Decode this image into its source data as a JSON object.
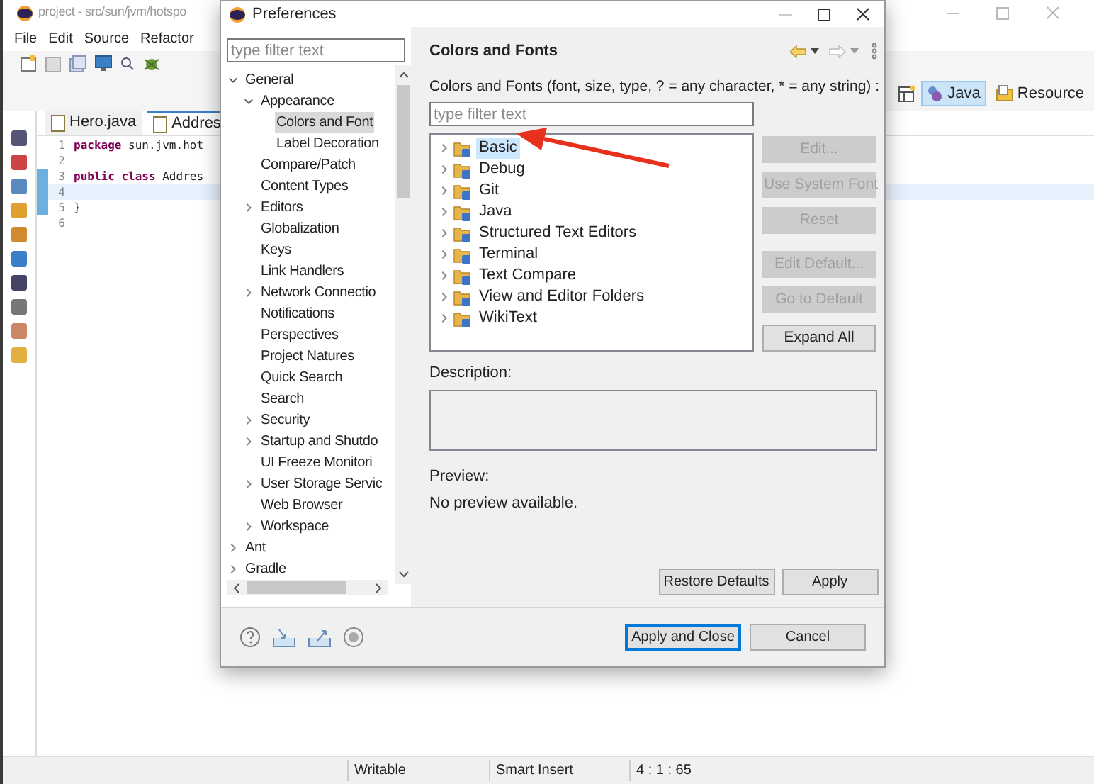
{
  "ide": {
    "title": "project - src/sun/jvm/hotspo",
    "menu": [
      "File",
      "Edit",
      "Source",
      "Refactor"
    ],
    "perspectives": [
      {
        "label": "Java",
        "selected": true
      },
      {
        "label": "Resource",
        "selected": false
      }
    ],
    "editor_tabs": [
      {
        "label": "Hero.java",
        "selected": false
      },
      {
        "label": "Addres",
        "selected": true
      }
    ],
    "code_lines": [
      {
        "number": "1",
        "current": false,
        "tokens": [
          {
            "text": "package",
            "kind": "keyword"
          },
          {
            "text": " sun.jvm.hot",
            "kind": "plain"
          }
        ]
      },
      {
        "number": "2",
        "current": false
      },
      {
        "number": "3",
        "current": false,
        "tokens": [
          {
            "text": "public class",
            "kind": "keyword"
          },
          {
            "text": " Addres",
            "kind": "plain"
          }
        ]
      },
      {
        "number": "4",
        "current": true
      },
      {
        "number": "5",
        "current": false,
        "tokens": [
          {
            "text": "}",
            "kind": "plain"
          }
        ]
      },
      {
        "number": "6",
        "current": false
      }
    ],
    "status_bar": [
      "Writable",
      "Smart Insert",
      "4 : 1 : 65"
    ]
  },
  "dialog": {
    "title": "Preferences",
    "filter": {
      "placeholder": "type filter text"
    },
    "tree": [
      {
        "label": "General",
        "kind": "group",
        "expanded": true,
        "selected": false,
        "children": [
          {
            "label": "Appearance",
            "kind": "group",
            "expanded": true,
            "selected": false,
            "children": [
              {
                "label": "Colors and Font",
                "kind": "page",
                "selected": true
              },
              {
                "label": "Label Decoration",
                "kind": "page",
                "selected": false
              }
            ]
          },
          {
            "label": "Compare/Patch",
            "kind": "page",
            "selected": false
          },
          {
            "label": "Content Types",
            "kind": "page",
            "selected": false
          },
          {
            "label": "Editors",
            "kind": "group",
            "expanded": false,
            "selected": false
          },
          {
            "label": "Globalization",
            "kind": "page",
            "selected": false
          },
          {
            "label": "Keys",
            "kind": "page",
            "selected": false
          },
          {
            "label": "Link Handlers",
            "kind": "page",
            "selected": false
          },
          {
            "label": "Network Connectio",
            "kind": "group",
            "expanded": false,
            "selected": false
          },
          {
            "label": "Notifications",
            "kind": "page",
            "selected": false
          },
          {
            "label": "Perspectives",
            "kind": "page",
            "selected": false
          },
          {
            "label": "Project Natures",
            "kind": "page",
            "selected": false
          },
          {
            "label": "Quick Search",
            "kind": "page",
            "selected": false
          },
          {
            "label": "Search",
            "kind": "page",
            "selected": false
          },
          {
            "label": "Security",
            "kind": "group",
            "expanded": false,
            "selected": false
          },
          {
            "label": "Startup and Shutdo",
            "kind": "group",
            "expanded": false,
            "selected": false
          },
          {
            "label": "UI Freeze Monitori",
            "kind": "page",
            "selected": false
          },
          {
            "label": "User Storage Servic",
            "kind": "group",
            "expanded": false,
            "selected": false
          },
          {
            "label": "Web Browser",
            "kind": "page",
            "selected": false
          },
          {
            "label": "Workspace",
            "kind": "group",
            "expanded": false,
            "selected": false
          }
        ]
      },
      {
        "label": "Ant",
        "kind": "group",
        "expanded": false,
        "selected": false
      },
      {
        "label": "Gradle",
        "kind": "group",
        "expanded": false,
        "selected": false
      }
    ],
    "page": {
      "title": "Colors and Fonts",
      "hint": "Colors and Fonts (font, size, type, ? = any character, * = any string) :",
      "filter": {
        "placeholder": "type filter text"
      },
      "items": [
        {
          "label": "Basic",
          "selected": true
        },
        {
          "label": "Debug",
          "selected": false
        },
        {
          "label": "Git",
          "selected": false
        },
        {
          "label": "Java",
          "selected": false
        },
        {
          "label": "Structured Text Editors",
          "selected": false
        },
        {
          "label": "Terminal",
          "selected": false
        },
        {
          "label": "Text Compare",
          "selected": false
        },
        {
          "label": "View and Editor Folders",
          "selected": false
        },
        {
          "label": "WikiText",
          "selected": false
        }
      ],
      "side_buttons": [
        {
          "label": "Edit...",
          "disabled": true
        },
        {
          "label": "Use System Font",
          "disabled": true
        },
        {
          "label": "Reset",
          "disabled": true
        },
        {
          "label": "Edit Default...",
          "disabled": true
        },
        {
          "label": "Go to Default",
          "disabled": true
        },
        {
          "label": "Expand All",
          "disabled": false
        }
      ],
      "description_label": "Description:",
      "preview_label": "Preview:",
      "preview_text": "No preview available.",
      "buttons": [
        "Restore Defaults",
        "Apply"
      ]
    },
    "footer_buttons": [
      {
        "label": "Apply and Close",
        "default": true
      },
      {
        "label": "Cancel",
        "default": false
      }
    ]
  }
}
